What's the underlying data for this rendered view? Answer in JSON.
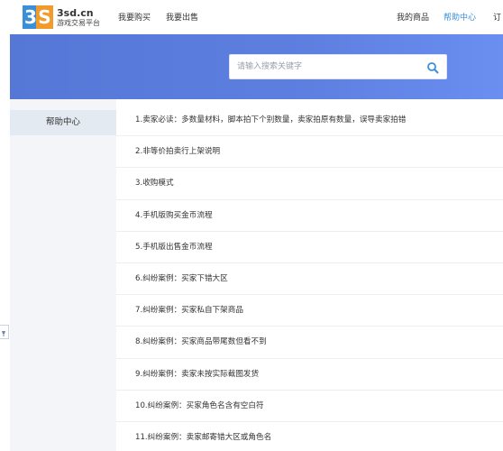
{
  "logo": {
    "mark_left": "3",
    "mark_right": "S",
    "domain": "3sd.cn",
    "subtitle": "游戏交易平台"
  },
  "nav": {
    "buy": "我要购买",
    "sell": "我要出售",
    "my_goods": "我的商品",
    "help": "帮助中心",
    "orders": "订"
  },
  "search": {
    "placeholder": "请输入搜索关键字"
  },
  "sidebar": {
    "items": [
      {
        "label": "帮助中心"
      }
    ]
  },
  "articles": [
    "1.卖家必读：多数量材料，脚本拍下个别数量，卖家拍原有数量，误导卖家拍错",
    "2.非等价拍卖行上架说明",
    "3.收购模式",
    "4.手机版购买金币流程",
    "5.手机版出售金币流程",
    "6.纠纷案例：买家下错大区",
    "7.纠纷案例：买家私自下架商品",
    "8.纠纷案例：买家商品带尾数但看不到",
    "9.纠纷案例：卖家未按实际截图发货",
    "10.纠纷案例：买家角色名含有空白符",
    "11.纠纷案例：卖家邮寄错大区或角色名"
  ],
  "colors": {
    "accent": "#3a8fd8",
    "banner": "#5a7ddd",
    "logo_blue": "#3a8fd8",
    "logo_orange": "#f29b2d"
  },
  "icons": {
    "search": "search-icon",
    "side_tab": "pin-icon"
  }
}
